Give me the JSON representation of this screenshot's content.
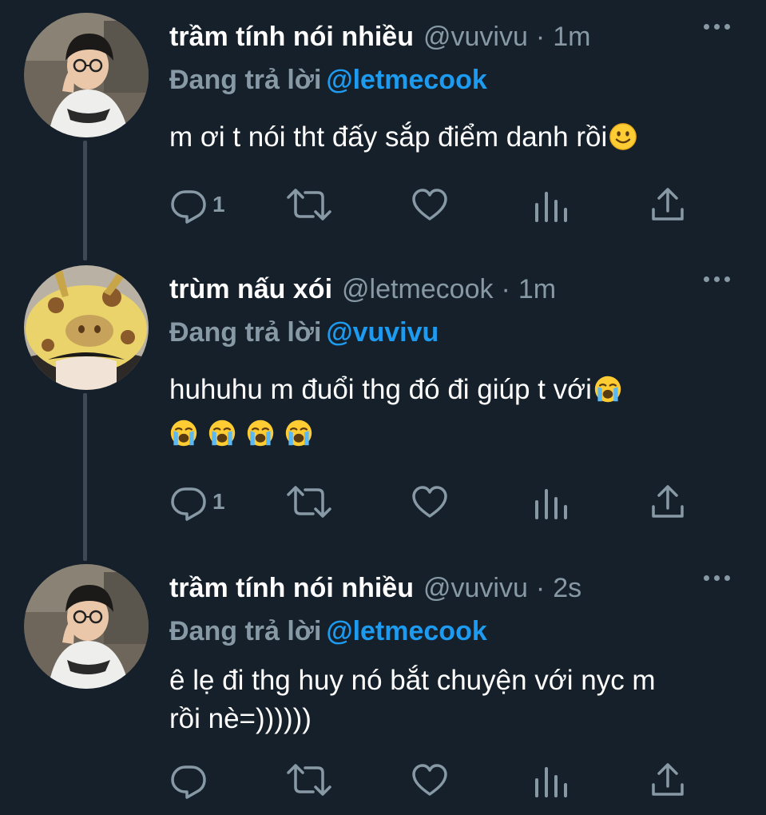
{
  "tweets": [
    {
      "display_name": "trầm tính nói nhiều",
      "handle": "@vuvivu",
      "separator": "·",
      "time": "1m",
      "replying_prefix": "Đang trả lời",
      "replying_to": "@letmecook",
      "text": "m ơi t nói tht đấy sắp điểm danh rồi",
      "text_emoji": "slightly-smiling-face",
      "reply_count": "1",
      "avatar": "glasses-boy-avatar"
    },
    {
      "display_name": "trùm nấu xói",
      "handle": "@letmecook",
      "separator": "·",
      "time": "1m",
      "replying_prefix": "Đang trả lời",
      "replying_to": "@vuvivu",
      "text": "huhuhu m đuổi thg đó đi giúp t với",
      "text_emoji": "loudly-crying-face",
      "extra_emojis": [
        "loudly-crying-face",
        "loudly-crying-face",
        "loudly-crying-face",
        "loudly-crying-face"
      ],
      "reply_count": "1",
      "avatar": "giraffe-hat-avatar"
    },
    {
      "display_name": "trầm tính nói nhiều",
      "handle": "@vuvivu",
      "separator": "·",
      "time": "2s",
      "replying_prefix": "Đang trả lời",
      "replying_to": "@letmecook",
      "text_line1": "ê lẹ đi thg huy nó bắt chuyện với nyc m",
      "text_line2": "rồi nè=))))))",
      "reply_count": "",
      "avatar": "glasses-boy-avatar"
    }
  ],
  "icons": [
    "reply-icon",
    "retweet-icon",
    "like-icon",
    "analytics-icon",
    "share-icon",
    "more-icon"
  ],
  "colors": {
    "background": "#15202b",
    "secondary_text": "#8899a6",
    "mention": "#1d9bf0",
    "thread_line": "#3d4955",
    "primary_text": "#ffffff"
  }
}
